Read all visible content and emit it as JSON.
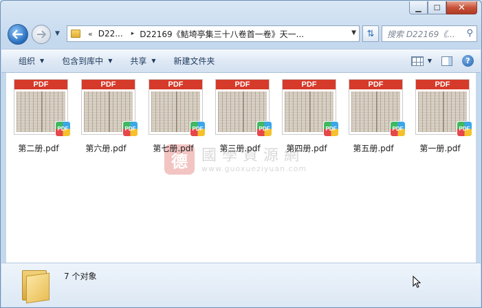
{
  "window": {
    "minimize": "▁",
    "maximize": "☐",
    "close": "✕"
  },
  "nav": {
    "address_overflow": "«",
    "address_segments": [
      "D22...",
      "D22169《鮚埼亭集三十八卷首一卷》天一..."
    ],
    "separator": "▸",
    "search_placeholder": "搜索 D22169《..."
  },
  "toolbar": {
    "items": [
      "组织",
      "包含到库中",
      "共享",
      "新建文件夹"
    ]
  },
  "files": [
    {
      "name": "第二册.pdf",
      "badge": "PDF",
      "header": "PDF"
    },
    {
      "name": "第六册.pdf",
      "badge": "PDF",
      "header": "PDF"
    },
    {
      "name": "第七册.pdf",
      "badge": "PDF",
      "header": "PDF"
    },
    {
      "name": "第三册.pdf",
      "badge": "PDF",
      "header": "PDF"
    },
    {
      "name": "第四册.pdf",
      "badge": "PDF",
      "header": "PDF"
    },
    {
      "name": "第五册.pdf",
      "badge": "PDF",
      "header": "PDF"
    },
    {
      "name": "第一册.pdf",
      "badge": "PDF",
      "header": "PDF"
    }
  ],
  "watermark": {
    "seal": "德",
    "title": "國學資源網",
    "url": "www.guoxueziyuan.com"
  },
  "details": {
    "count_text": "7 个对象"
  }
}
